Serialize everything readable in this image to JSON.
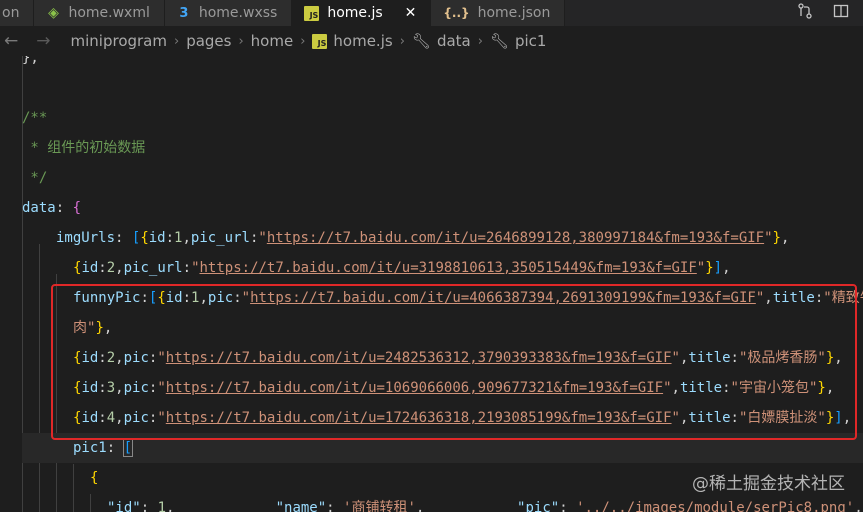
{
  "tabs": [
    {
      "label": "on",
      "icon": "none"
    },
    {
      "label": "home.wxml",
      "icon": "wxml-icon"
    },
    {
      "label": "home.wxss",
      "icon": "css-icon"
    },
    {
      "label": "home.js",
      "icon": "js-icon",
      "active": true
    },
    {
      "label": "home.json",
      "icon": "json-icon"
    }
  ],
  "tab_icons": {
    "js": "JS",
    "css": "3",
    "wxml": "◈",
    "json": "{..}",
    "close": "✕"
  },
  "breadcrumb": [
    "miniprogram",
    "pages",
    "home",
    "home.js",
    "data",
    "pic1"
  ],
  "code": {
    "l1": "},",
    "l2": "/**",
    "l3": " * 组件的初始数据",
    "l4": " */",
    "data_key": "data",
    "imgUrls_key": "imgUrls",
    "pic_url_key": "pic_url",
    "funnyPic_key": "funnyPic",
    "pic_key": "pic",
    "title_key": "title",
    "id_key": "id",
    "pic1_key": "pic1",
    "imgUrls": [
      {
        "id": "1",
        "url": "https://t7.baidu.com/it/u=2646899128,380997184&fm=193&f=GIF"
      },
      {
        "id": "2",
        "url": "https://t7.baidu.com/it/u=3198810613,350515449&fm=193&f=GIF"
      }
    ],
    "funnyPic": [
      {
        "id": "1",
        "url": "https://t7.baidu.com/it/u=4066387394,2691309199&fm=193&f=GIF",
        "title_part1": "精致牛",
        "title_part2": "肉"
      },
      {
        "id": "2",
        "url": "https://t7.baidu.com/it/u=2482536312,3790393383&fm=193&f=GIF",
        "title": "极品烤香肠"
      },
      {
        "id": "3",
        "url": "https://t7.baidu.com/it/u=1069066006,909677321&fm=193&f=GIF",
        "title": "宇宙小笼包"
      },
      {
        "id": "4",
        "url": "https://t7.baidu.com/it/u=1724636318,2193085199&fm=193&f=GIF",
        "title": "白嫖膜扯淡"
      }
    ],
    "last_line": {
      "id_str": "\"id\"",
      "id_val": "1",
      "name_str": "\"name\"",
      "name_val": "'商铺转租'",
      "pic_str": "\"pic\"",
      "pic_val": "'../../images/module/serPic8.png'"
    }
  },
  "watermark": "@稀土掘金技术社区",
  "colors": {
    "highlight_box": "#e02828",
    "string": "#ce9178",
    "keyword": "#4ec9b0",
    "comment": "#6a9955",
    "number": "#b5cea8"
  }
}
